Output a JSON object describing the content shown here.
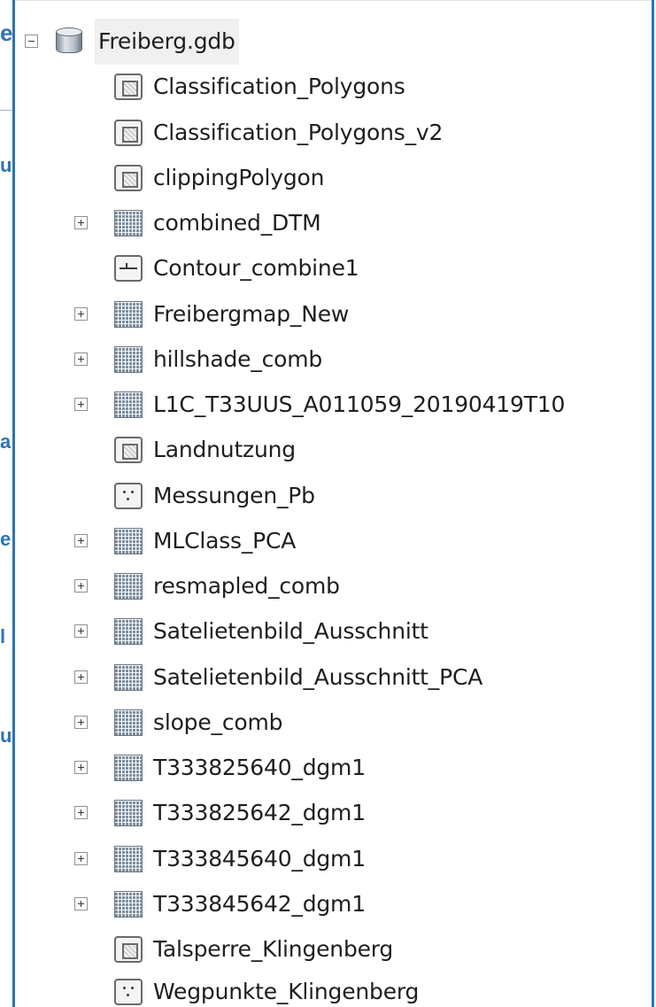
{
  "background_fragments": [
    "e",
    "u",
    "a",
    "e",
    "l",
    "ut"
  ],
  "tree": {
    "root": {
      "label": "Freiberg.gdb",
      "icon": "geodatabase-icon",
      "expanded": true
    },
    "items": [
      {
        "label": "Classification_Polygons",
        "icon": "polygon-feature-class-icon",
        "expandable": false
      },
      {
        "label": "Classification_Polygons_v2",
        "icon": "polygon-feature-class-icon",
        "expandable": false
      },
      {
        "label": "clippingPolygon",
        "icon": "polygon-feature-class-icon",
        "expandable": false
      },
      {
        "label": "combined_DTM",
        "icon": "raster-dataset-icon",
        "expandable": true
      },
      {
        "label": "Contour_combine1",
        "icon": "line-feature-class-icon",
        "expandable": false
      },
      {
        "label": "Freibergmap_New",
        "icon": "raster-dataset-icon",
        "expandable": true
      },
      {
        "label": "hillshade_comb",
        "icon": "raster-dataset-icon",
        "expandable": true
      },
      {
        "label": "L1C_T33UUS_A011059_20190419T10",
        "icon": "raster-dataset-icon",
        "expandable": true
      },
      {
        "label": "Landnutzung",
        "icon": "polygon-feature-class-icon",
        "expandable": false
      },
      {
        "label": "Messungen_Pb",
        "icon": "point-feature-class-icon",
        "expandable": false
      },
      {
        "label": "MLClass_PCA",
        "icon": "raster-dataset-icon",
        "expandable": true
      },
      {
        "label": "resmapled_comb",
        "icon": "raster-dataset-icon",
        "expandable": true
      },
      {
        "label": "Satelietenbild_Ausschnitt",
        "icon": "raster-dataset-icon",
        "expandable": true
      },
      {
        "label": "Satelietenbild_Ausschnitt_PCA",
        "icon": "raster-dataset-icon",
        "expandable": true
      },
      {
        "label": "slope_comb",
        "icon": "raster-dataset-icon",
        "expandable": true
      },
      {
        "label": "T333825640_dgm1",
        "icon": "raster-dataset-icon",
        "expandable": true
      },
      {
        "label": "T333825642_dgm1",
        "icon": "raster-dataset-icon",
        "expandable": true
      },
      {
        "label": "T333845640_dgm1",
        "icon": "raster-dataset-icon",
        "expandable": true
      },
      {
        "label": "T333845642_dgm1",
        "icon": "raster-dataset-icon",
        "expandable": true
      },
      {
        "label": "Talsperre_Klingenberg",
        "icon": "polygon-feature-class-icon",
        "expandable": false
      },
      {
        "label": "Wegpunkte_Klingenberg",
        "icon": "point-feature-class-icon",
        "expandable": false
      }
    ]
  },
  "colors": {
    "panel_border": "#2e74b5",
    "background_text": "#2e74b5"
  }
}
